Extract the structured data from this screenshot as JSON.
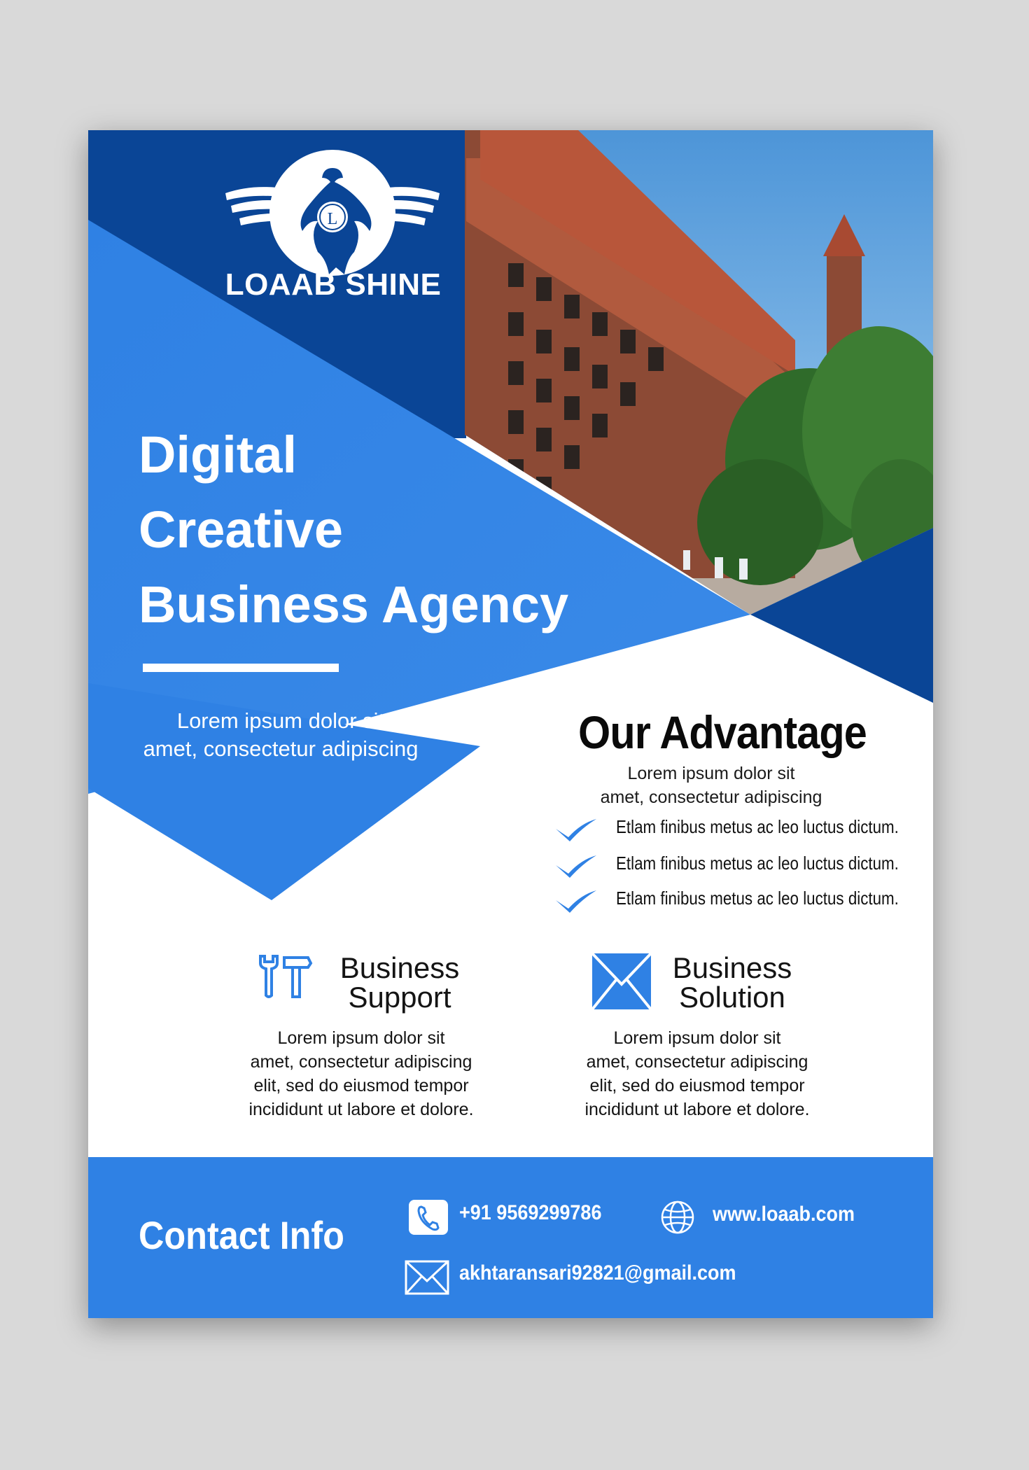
{
  "brand": {
    "name": "LOAAB SHINE",
    "logo_letter": "L"
  },
  "hero": {
    "title_lines": [
      "Digital",
      "Creative",
      "Business Agency"
    ],
    "subtitle_lines": [
      "Lorem ipsum dolor sit",
      "amet, consectetur adipiscing"
    ]
  },
  "advantage": {
    "title": "Our Advantage",
    "subtitle_lines": [
      "Lorem ipsum dolor sit",
      "amet, consectetur adipiscing"
    ],
    "items": [
      "Etlam finibus metus ac leo luctus dictum.",
      "Etlam finibus metus ac leo luctus dictum.",
      "Etlam finibus metus ac leo luctus dictum."
    ]
  },
  "services": [
    {
      "title_lines": [
        "Business",
        "Support"
      ],
      "icon": "tools-icon",
      "body_lines": [
        "Lorem ipsum dolor sit",
        "amet, consectetur adipiscing",
        "elit, sed do eiusmod tempor",
        "incididunt ut labore et dolore."
      ]
    },
    {
      "title_lines": [
        "Business",
        "Solution"
      ],
      "icon": "envelope-icon",
      "body_lines": [
        "Lorem ipsum dolor sit",
        "amet, consectetur adipiscing",
        "elit, sed do eiusmod tempor",
        "incididunt ut labore et dolore."
      ]
    }
  ],
  "contact": {
    "title": "Contact Info",
    "phone": "+91 9569299786",
    "website": "www.loaab.com",
    "email": "akhtaransari92821@gmail.com"
  },
  "colors": {
    "dark_blue": "#0a4596",
    "mid_blue": "#2f81e4",
    "white": "#ffffff",
    "background": "#d9d9d9"
  }
}
